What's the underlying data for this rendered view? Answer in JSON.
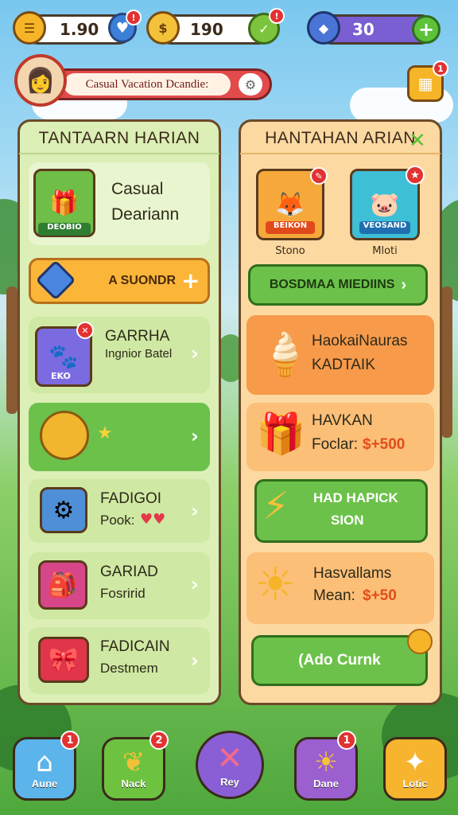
{
  "topbar": {
    "currency1_value": "1.90",
    "currency2_value": "190",
    "currency3_value": "30",
    "currency1_badge": "!",
    "currency2_badge": "!"
  },
  "banner": {
    "text": "Casual Vacation Dcandie:",
    "calendar_badge": "1"
  },
  "left_panel": {
    "title": "TANTAARN HARIAN",
    "featured": {
      "title": "Casual",
      "subtitle": "Deariann",
      "tag": "DEOBIO"
    },
    "action_button": "A SUONDR",
    "items": [
      {
        "title": "GARRHA",
        "subtitle": "Ingnior Batel",
        "tag": "EKO"
      },
      {
        "title": "",
        "subtitle": ""
      },
      {
        "title": "FADIGOI",
        "subtitle": "Pook:"
      },
      {
        "title": "GARIAD",
        "subtitle": "Fosririd"
      },
      {
        "title": "FADICAIN",
        "subtitle": "Destmem"
      }
    ]
  },
  "right_panel": {
    "title": "HANTAHAN ARIAN",
    "cards": [
      {
        "tag": "BEIKON",
        "caption": "Stono"
      },
      {
        "tag": "VEOSAND",
        "caption": "Mloti"
      }
    ],
    "green_button": "BOSDMAA MIEDIINS",
    "items": [
      {
        "title": "HaokaiNauras",
        "subtitle": "KADTAIK"
      },
      {
        "title": "HAVKAN",
        "subtitle": "Foclar:",
        "price": "$+500"
      },
      {
        "title": "HAD HAPICK",
        "subtitle": "SION"
      },
      {
        "title": "Hasvallams",
        "subtitle": "Mean:",
        "price": "$+50"
      }
    ],
    "bottom_button": "(Ado Curnk"
  },
  "nav": [
    {
      "label": "Aune",
      "badge": "1",
      "icon": "home-icon",
      "color": "#5bb4ea"
    },
    {
      "label": "Nack",
      "badge": "2",
      "icon": "leaf-icon",
      "color": "#6dc33f"
    },
    {
      "label": "Rey",
      "badge": "",
      "icon": "close-icon",
      "color": "#8a5fd6"
    },
    {
      "label": "Dane",
      "badge": "1",
      "icon": "sun-icon",
      "color": "#9b5fd0"
    },
    {
      "label": "Lotic",
      "badge": "",
      "icon": "puzzle-icon",
      "color": "#f7b42e"
    }
  ],
  "colors": {
    "left_panel_bg": "#dcefb6",
    "right_panel_bg": "#fcd9a1",
    "accent_orange": "#fbb63a",
    "accent_green": "#63c23f"
  }
}
